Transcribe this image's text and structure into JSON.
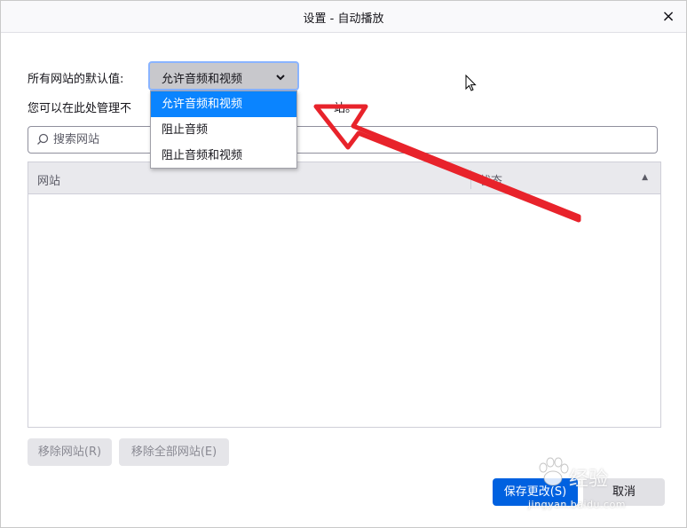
{
  "dialog": {
    "title": "设置 - 自动播放",
    "close_icon": "×"
  },
  "default_setting": {
    "label": "所有网站的默认值:",
    "selected": "允许音频和视频",
    "chevron_icon": "⌄",
    "options": [
      "允许音频和视频",
      "阻止音频",
      "阻止音频和视频"
    ]
  },
  "description": {
    "visible_start": "您可以在此处管理不",
    "visible_end": "站。"
  },
  "search": {
    "icon": "⌕",
    "placeholder": "搜索网站",
    "value": ""
  },
  "table": {
    "columns": [
      "网站",
      "状态"
    ],
    "sort_icon": "▲",
    "rows": []
  },
  "buttons": {
    "remove_site": "移除网站(R)",
    "remove_all": "移除全部网站(E)",
    "save": "保存更改(S)",
    "cancel": "取消"
  },
  "watermark": {
    "text": "经验",
    "sub": "jingyan.baidu.com"
  },
  "colors": {
    "accent": "#0061e0",
    "selected_option": "#0a84ff",
    "annotation_arrow": "#e8232b"
  }
}
